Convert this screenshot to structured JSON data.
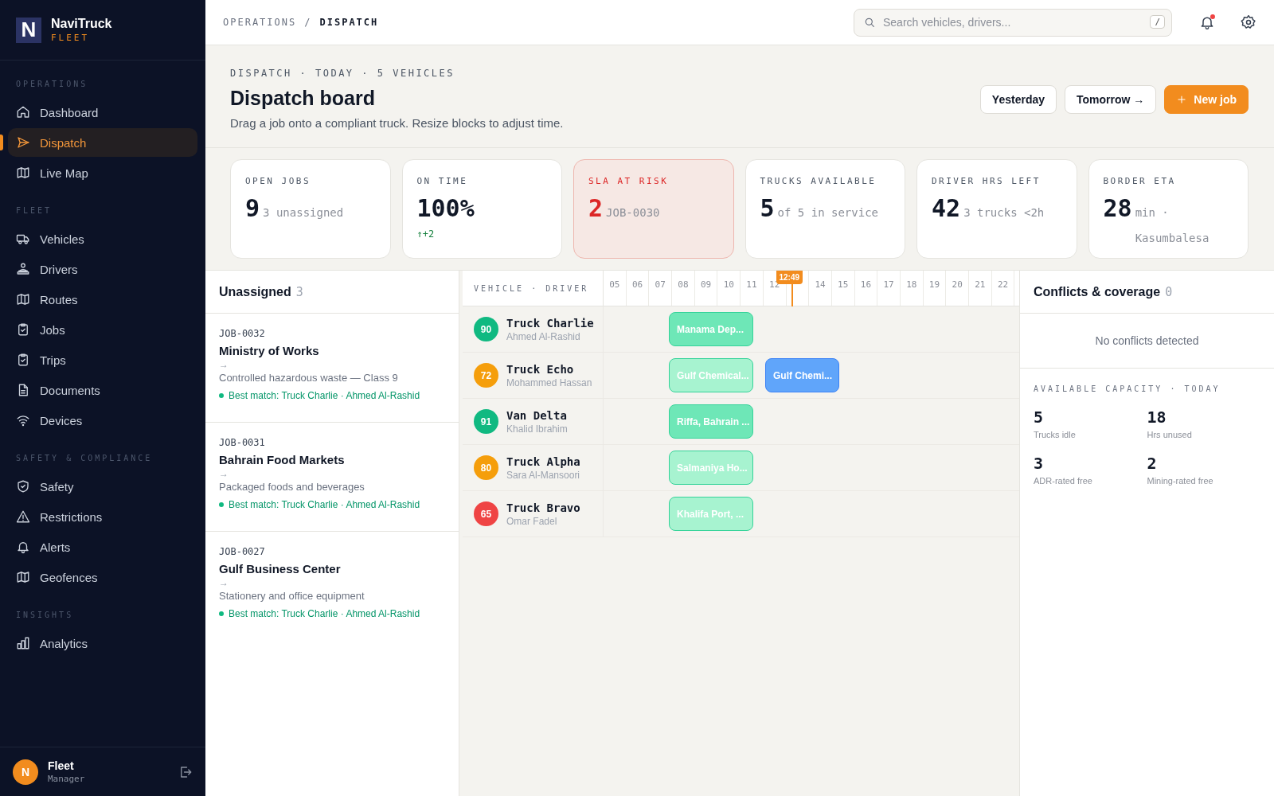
{
  "brand": {
    "name": "NaviTruck",
    "sub": "FLEET",
    "logo_letter": "N"
  },
  "sidebar": {
    "sections": [
      {
        "label": "OPERATIONS",
        "items": [
          {
            "label": "Dashboard",
            "selected": false
          },
          {
            "label": "Dispatch",
            "selected": true
          },
          {
            "label": "Live Map",
            "selected": false
          }
        ]
      },
      {
        "label": "FLEET",
        "items": [
          {
            "label": "Vehicles",
            "selected": false
          },
          {
            "label": "Drivers",
            "selected": false
          },
          {
            "label": "Routes",
            "selected": false
          },
          {
            "label": "Jobs",
            "selected": false
          },
          {
            "label": "Trips",
            "selected": false
          },
          {
            "label": "Documents",
            "selected": false
          },
          {
            "label": "Devices",
            "selected": false
          }
        ]
      },
      {
        "label": "SAFETY & COMPLIANCE",
        "items": [
          {
            "label": "Safety",
            "selected": false
          },
          {
            "label": "Restrictions",
            "selected": false
          },
          {
            "label": "Alerts",
            "selected": false
          },
          {
            "label": "Geofences",
            "selected": false
          }
        ]
      },
      {
        "label": "INSIGHTS",
        "items": [
          {
            "label": "Analytics",
            "selected": false
          }
        ]
      }
    ],
    "user": {
      "initial": "N",
      "name": "Fleet",
      "role": "Manager"
    }
  },
  "breadcrumb": [
    "OPERATIONS",
    "/",
    "DISPATCH"
  ],
  "search": {
    "placeholder": "Search vehicles, drivers...",
    "shortcut": "/"
  },
  "header": {
    "eyebrow": "DISPATCH · TODAY · 5 VEHICLES",
    "title": "Dispatch board",
    "subtitle": "Drag a job onto a compliant truck. Resize blocks to adjust time.",
    "buttons": [
      {
        "label": "Yesterday",
        "kind": "plain"
      },
      {
        "label": "Tomorrow →",
        "kind": "plain"
      },
      {
        "label": "New job",
        "kind": "primary"
      }
    ]
  },
  "kpis": [
    {
      "label": "OPEN JOBS",
      "value": "9",
      "note": "3 unassigned",
      "kind": "normal"
    },
    {
      "label": "ON TIME",
      "value": "100%",
      "trend": "↑+2",
      "kind": "normal"
    },
    {
      "label": "SLA AT RISK",
      "value": "2",
      "note": "JOB-0030",
      "kind": "risk"
    },
    {
      "label": "TRUCKS AVAILABLE",
      "value": "5",
      "note": "of 5 in service",
      "kind": "normal"
    },
    {
      "label": "DRIVER HRS LEFT",
      "value": "42",
      "note": "3 trucks <2h",
      "kind": "normal"
    },
    {
      "label": "BORDER ETA",
      "value": "28",
      "note": "min · Kasumbalesa",
      "kind": "normal"
    }
  ],
  "unassigned": {
    "title": "Unassigned",
    "count": "3",
    "jobs": [
      {
        "id": "JOB-0032",
        "customer": "Ministry of Works",
        "arrow": "→",
        "cargo": "Controlled hazardous waste — Class 9",
        "match": "Best match: Truck Charlie · Ahmed Al-Rashid"
      },
      {
        "id": "JOB-0031",
        "customer": "Bahrain Food Markets",
        "arrow": "→",
        "cargo": "Packaged foods and beverages",
        "match": "Best match: Truck Charlie · Ahmed Al-Rashid"
      },
      {
        "id": "JOB-0027",
        "customer": "Gulf Business Center",
        "arrow": "→",
        "cargo": "Stationery and office equipment",
        "match": "Best match: Truck Charlie · Ahmed Al-Rashid"
      }
    ]
  },
  "timeline": {
    "column_label": "VEHICLE · DRIVER",
    "hours": [
      "05",
      "06",
      "07",
      "08",
      "09",
      "10",
      "11",
      "12"
    ],
    "now": "12:49",
    "hours_after": [
      "14",
      "15",
      "16",
      "17",
      "18",
      "19",
      "20",
      "21",
      "22"
    ],
    "rows": [
      {
        "vehicle": "Truck Charlie",
        "driver": "Ahmed Al-Rashid",
        "score": "90",
        "color": "#10b981",
        "blocks": [
          {
            "label": "Manama Dep...",
            "color": "#6ee7b7"
          }
        ]
      },
      {
        "vehicle": "Truck Echo",
        "driver": "Mohammed Hassan",
        "score": "72",
        "color": "#f59e0b",
        "blocks": [
          {
            "label": "Gulf Chemical...",
            "color": "#a7f3d0"
          },
          {
            "label": "Gulf Chemi...",
            "color": "#60a5fa"
          }
        ]
      },
      {
        "vehicle": "Van Delta",
        "driver": "Khalid Ibrahim",
        "score": "91",
        "color": "#10b981",
        "blocks": [
          {
            "label": "Riffa, Bahrain ...",
            "color": "#6ee7b7"
          }
        ]
      },
      {
        "vehicle": "Truck Alpha",
        "driver": "Sara Al-Mansoori",
        "score": "80",
        "color": "#f59e0b",
        "blocks": [
          {
            "label": "Salmaniya Ho...",
            "color": "#a7f3d0"
          }
        ]
      },
      {
        "vehicle": "Truck Bravo",
        "driver": "Omar Fadel",
        "score": "65",
        "color": "#ef4444",
        "blocks": [
          {
            "label": "Khalifa Port, ...",
            "color": "#a7f3d0"
          }
        ]
      }
    ]
  },
  "conflicts": {
    "title": "Conflicts & coverage",
    "count": "0",
    "empty": "No conflicts detected",
    "capacity_label": "AVAILABLE CAPACITY · TODAY",
    "capacity": [
      {
        "value": "5",
        "label": "Trucks idle"
      },
      {
        "value": "18",
        "label": "Hrs unused"
      },
      {
        "value": "3",
        "label": "ADR-rated free"
      },
      {
        "value": "2",
        "label": "Mining-rated free"
      }
    ]
  }
}
